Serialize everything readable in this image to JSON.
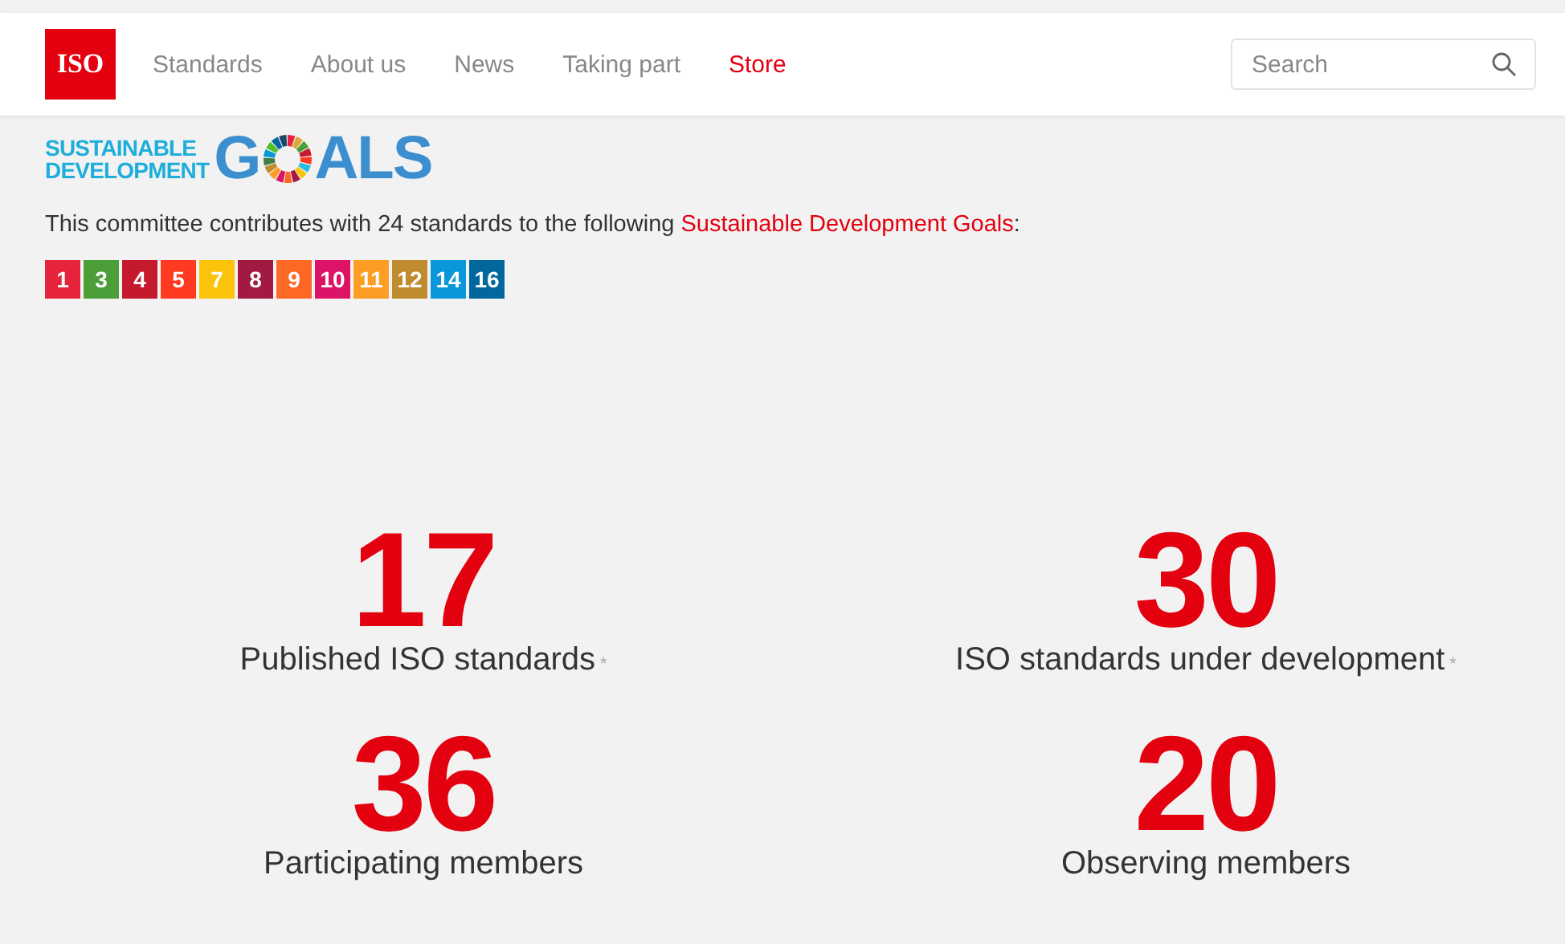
{
  "header": {
    "logo": "ISO",
    "nav": [
      {
        "label": "Standards",
        "kind": "link"
      },
      {
        "label": "About us",
        "kind": "link"
      },
      {
        "label": "News",
        "kind": "link"
      },
      {
        "label": "Taking part",
        "kind": "link"
      },
      {
        "label": "Store",
        "kind": "accent"
      }
    ],
    "search": {
      "placeholder": "Search"
    }
  },
  "sdg": {
    "logo": {
      "line1": "SUSTAINABLE",
      "line2": "DEVELOPMENT",
      "word_start": "G",
      "word_end": "ALS"
    },
    "intro": "This committee contributes with 24 standards to the following ",
    "intro_link": "Sustainable Development Goals",
    "intro_end": ":",
    "goals": [
      {
        "label": "1",
        "color": "#e5243b"
      },
      {
        "label": "3",
        "color": "#4c9f38"
      },
      {
        "label": "4",
        "color": "#c5192d"
      },
      {
        "label": "5",
        "color": "#ff3a21"
      },
      {
        "label": "7",
        "color": "#fcc30b"
      },
      {
        "label": "8",
        "color": "#a21942"
      },
      {
        "label": "9",
        "color": "#fd6925"
      },
      {
        "label": "10",
        "color": "#dd1367"
      },
      {
        "label": "11",
        "color": "#fd9d24"
      },
      {
        "label": "12",
        "color": "#bf8b2e"
      },
      {
        "label": "14",
        "color": "#0a97d9"
      },
      {
        "label": "16",
        "color": "#00689d"
      }
    ]
  },
  "stats": [
    {
      "number": "17",
      "label": "Published ISO standards",
      "note": "*"
    },
    {
      "number": "30",
      "label": "ISO standards under development",
      "note": "*"
    },
    {
      "number": "36",
      "label": "Participating members"
    },
    {
      "number": "20",
      "label": "Observing members"
    }
  ]
}
